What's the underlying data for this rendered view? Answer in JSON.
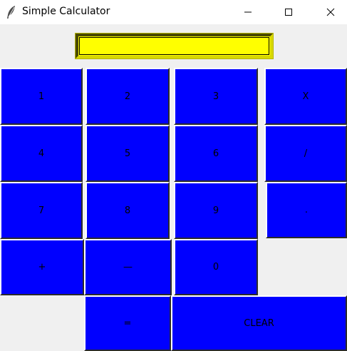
{
  "window": {
    "title": "Simple Calculator"
  },
  "display": {
    "value": "",
    "color": "#ffff00"
  },
  "keys": {
    "k1": "1",
    "k2": "2",
    "k3": "3",
    "k_mul": "X",
    "k4": "4",
    "k5": "5",
    "k6": "6",
    "k_div": "/",
    "k7": "7",
    "k8": "8",
    "k9": "9",
    "k_dot": ".",
    "k_plus": "+",
    "k_minus": "—",
    "k0": "0",
    "k_eq": "=",
    "k_clear": "CLEAR"
  },
  "colors": {
    "key_background": "#0000ff",
    "window_background": "#f0f0f0"
  },
  "icons": {
    "app": "feather-icon",
    "minimize": "minimize-icon",
    "maximize": "maximize-icon",
    "close": "close-icon"
  }
}
